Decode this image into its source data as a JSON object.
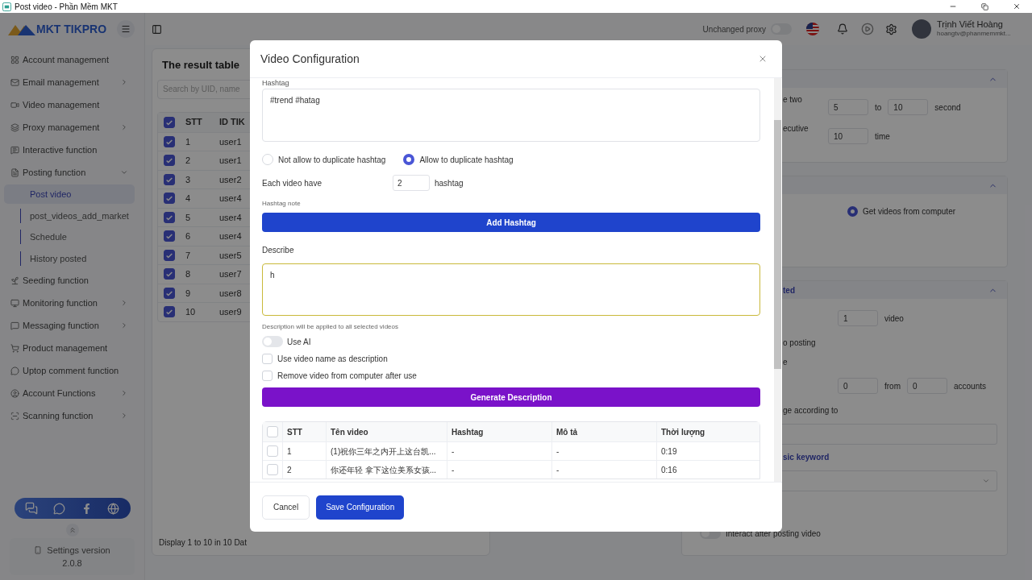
{
  "window": {
    "title": "Post video - Phần Mềm MKT"
  },
  "sidebar": {
    "logo": "MKT TIKPRO",
    "items": [
      {
        "label": "Account management",
        "has_submenu": false
      },
      {
        "label": "Email management",
        "has_submenu": true,
        "expanded": false
      },
      {
        "label": "Video management",
        "has_submenu": false
      },
      {
        "label": "Proxy management",
        "has_submenu": true,
        "expanded": false
      },
      {
        "label": "Interactive function",
        "has_submenu": false
      },
      {
        "label": "Posting function",
        "has_submenu": true,
        "expanded": true,
        "children": [
          {
            "label": "Post video",
            "selected": true
          },
          {
            "label": "post_videos_add_market",
            "selected": false
          },
          {
            "label": "Schedule",
            "selected": false
          },
          {
            "label": "History posted",
            "selected": false
          }
        ]
      },
      {
        "label": "Seeding function",
        "has_submenu": false
      },
      {
        "label": "Monitoring function",
        "has_submenu": true,
        "expanded": false
      },
      {
        "label": "Messaging function",
        "has_submenu": true,
        "expanded": false
      },
      {
        "label": "Product management",
        "has_submenu": false
      },
      {
        "label": "Uptop comment function",
        "has_submenu": false
      },
      {
        "label": "Account Functions",
        "has_submenu": true,
        "expanded": false
      },
      {
        "label": "Scanning function",
        "has_submenu": true,
        "expanded": false
      }
    ],
    "version": {
      "label": "Settings version",
      "number": "2.0.8"
    }
  },
  "header": {
    "proxy_label": "Unchanged proxy",
    "proxy_on": false,
    "user": {
      "name": "Trịnh Viết Hoàng",
      "email": "hoangtv@phanmemmkt..."
    }
  },
  "result_table": {
    "title": "The result table",
    "search_placeholder": "Search by UID, name",
    "columns": [
      "STT",
      "ID TIK"
    ],
    "all_checked": true,
    "rows": [
      {
        "stt": "1",
        "id": "user1",
        "checked": true
      },
      {
        "stt": "2",
        "id": "user1",
        "checked": true
      },
      {
        "stt": "3",
        "id": "user2",
        "checked": true
      },
      {
        "stt": "4",
        "id": "user4",
        "checked": true
      },
      {
        "stt": "5",
        "id": "user4",
        "checked": true
      },
      {
        "stt": "6",
        "id": "user4",
        "checked": true
      },
      {
        "stt": "7",
        "id": "user5",
        "checked": true
      },
      {
        "stt": "8",
        "id": "user7",
        "checked": true
      },
      {
        "stt": "9",
        "id": "user8",
        "checked": true
      },
      {
        "stt": "10",
        "id": "user9",
        "checked": true
      }
    ],
    "footer": "Display 1 to 10 in 10 Dat"
  },
  "settings_panel": {
    "sections": [
      {
        "expanded": true,
        "rows": [
          {
            "kind": "range",
            "label": "e two",
            "from": "5",
            "to_label": "to",
            "to": "10",
            "unit": "second"
          },
          {
            "kind": "single",
            "label": "ecutive",
            "value": "10",
            "unit": "time"
          }
        ]
      },
      {
        "expanded": true,
        "rows": [
          {
            "kind": "radio",
            "label": "Get videos from computer",
            "selected": true
          }
        ]
      },
      {
        "title": "ted",
        "expanded": true,
        "rows": [
          {
            "kind": "single",
            "value": "1",
            "unit": "video"
          },
          {
            "kind": "text",
            "label": "o posting"
          },
          {
            "kind": "text",
            "label": "e"
          },
          {
            "kind": "range",
            "from": "0",
            "to_label": "from",
            "to": "0",
            "unit": "accounts"
          },
          {
            "kind": "text",
            "label": "ge according to"
          },
          {
            "kind": "input"
          },
          {
            "kind": "link",
            "label": "sic keyword"
          },
          {
            "kind": "select"
          },
          {
            "kind": "toggle",
            "label": "Interact after posting video",
            "on": false
          }
        ]
      }
    ]
  },
  "modal": {
    "title": "Video Configuration",
    "hashtag": {
      "label": "Hashtag",
      "value": "#trend #hatag"
    },
    "duplicate_options": [
      {
        "label": "Not allow to duplicate hashtag",
        "selected": false
      },
      {
        "label": "Allow to duplicate hashtag",
        "selected": true
      }
    ],
    "count": {
      "label": "Each video have",
      "value": "2",
      "unit": "hashtag"
    },
    "hashtag_note": "Hashtag note",
    "add_button": "Add Hashtag",
    "describe": {
      "label": "Describe",
      "value": "h",
      "help": "Description will be applied to all selected videos"
    },
    "use_ai": {
      "label": "Use AI",
      "on": false
    },
    "options": [
      {
        "label": "Use video name as description",
        "checked": false
      },
      {
        "label": "Remove video from computer after use",
        "checked": false
      }
    ],
    "generate_button": "Generate Description",
    "videos": {
      "columns": [
        "STT",
        "Tên video",
        "Hashtag",
        "Mô tả",
        "Thời lượng"
      ],
      "all_checked": false,
      "rows": [
        {
          "stt": "1",
          "name": "(1)祝你三年之内开上这台凯...",
          "hashtag": "-",
          "description": "-",
          "duration": "0:19",
          "checked": false
        },
        {
          "stt": "2",
          "name": "你还年轻 拿下这位美系女孩...",
          "hashtag": "-",
          "description": "-",
          "duration": "0:16",
          "checked": false
        }
      ]
    },
    "cancel": "Cancel",
    "save": "Save Configuration"
  }
}
